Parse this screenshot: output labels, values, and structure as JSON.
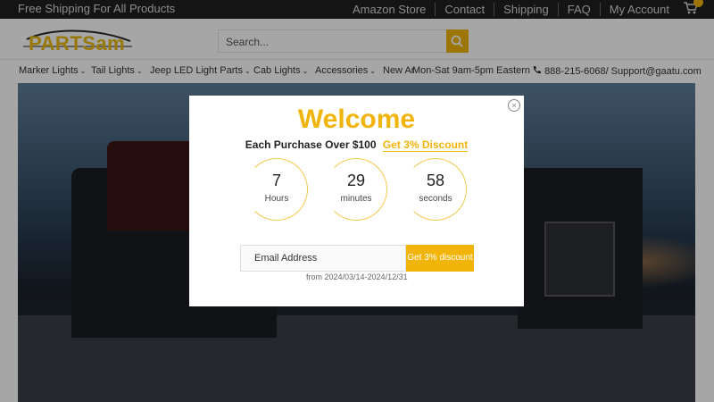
{
  "topbar": {
    "shipping": "Free Shipping For All Products",
    "links": [
      "Amazon Store",
      "Contact",
      "Shipping",
      "FAQ",
      "My Account"
    ]
  },
  "header": {
    "logo": "PARTSam",
    "search_placeholder": "Search..."
  },
  "nav": {
    "items": [
      "Marker Lights",
      "Tail Lights",
      "Jeep LED Light Parts",
      "Cab Lights",
      "Accessories",
      "New Ar"
    ],
    "hours": "Mon-Sat 9am-5pm Eastern",
    "contact": "888-215-6068/ Support@gaatu.com"
  },
  "popup": {
    "title": "Welcome",
    "offer": "Each Purchase Over $100",
    "discount_link": "Get 3% Discount",
    "countdown": [
      {
        "value": "7",
        "unit": "Hours"
      },
      {
        "value": "29",
        "unit": "minutes"
      },
      {
        "value": "58",
        "unit": "seconds"
      }
    ],
    "email_placeholder": "Email Address",
    "button": "Get 3% discount",
    "date_range": "from 2024/03/14-2024/12/31",
    "close_glyph": "×"
  },
  "colors": {
    "accent": "#f1b409",
    "topbar": "#1f1f1f"
  }
}
